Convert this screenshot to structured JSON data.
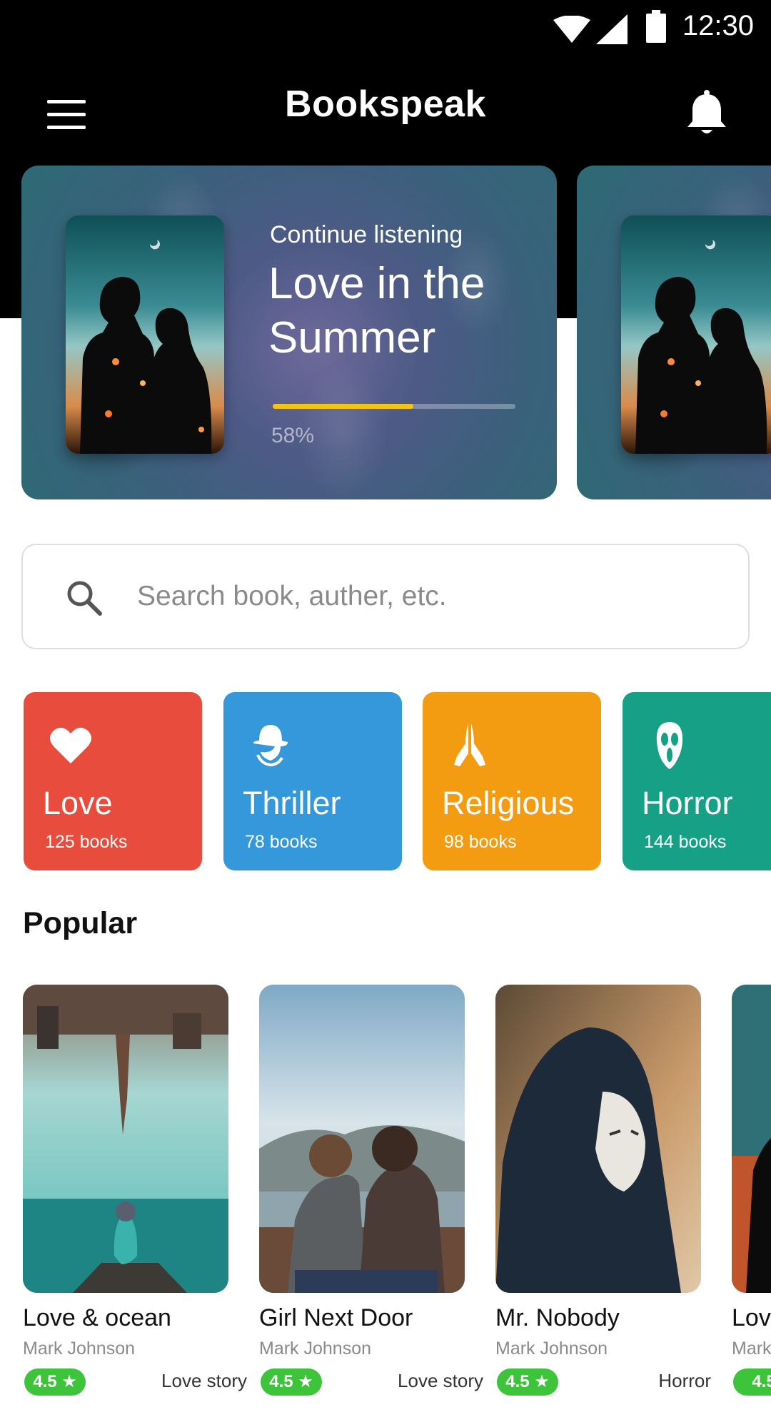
{
  "status_bar": {
    "time": "12:30"
  },
  "app_bar": {
    "title": "Bookspeak"
  },
  "continue_cards": [
    {
      "label": "Continue listening",
      "title": "Love in the Summer",
      "progress_percent": 58,
      "progress_text": "58%"
    },
    {
      "label": "",
      "title": "",
      "progress_percent": 0,
      "progress_text": ""
    }
  ],
  "search": {
    "placeholder": "Search book, auther, etc."
  },
  "categories": [
    {
      "name": "Love",
      "count": "125 books",
      "color": "#e74c3c",
      "icon": "heart-icon"
    },
    {
      "name": "Thriller",
      "count": "78 books",
      "color": "#3498db",
      "icon": "spy-icon"
    },
    {
      "name": "Religious",
      "count": "98 books",
      "color": "#f39c12",
      "icon": "praying-hands-icon"
    },
    {
      "name": "Horror",
      "count": "144 books",
      "color": "#16a085",
      "icon": "ghost-mask-icon"
    }
  ],
  "popular": {
    "title": "Popular",
    "books": [
      {
        "title": "Love & ocean",
        "author": "Mark Johnson",
        "rating": "4.5 ★",
        "genre": "Love story"
      },
      {
        "title": "Girl Next Door",
        "author": "Mark Johnson",
        "rating": "4.5 ★",
        "genre": "Love story"
      },
      {
        "title": "Mr. Nobody",
        "author": "Mark Johnson",
        "rating": "4.5 ★",
        "genre": "Horror"
      },
      {
        "title": "Lov",
        "author": "Mark",
        "rating": "4.5",
        "genre": ""
      }
    ]
  },
  "colors": {
    "accent_progress": "#f3c418",
    "rating_green": "#3ec43a",
    "header_bg": "#000000"
  }
}
